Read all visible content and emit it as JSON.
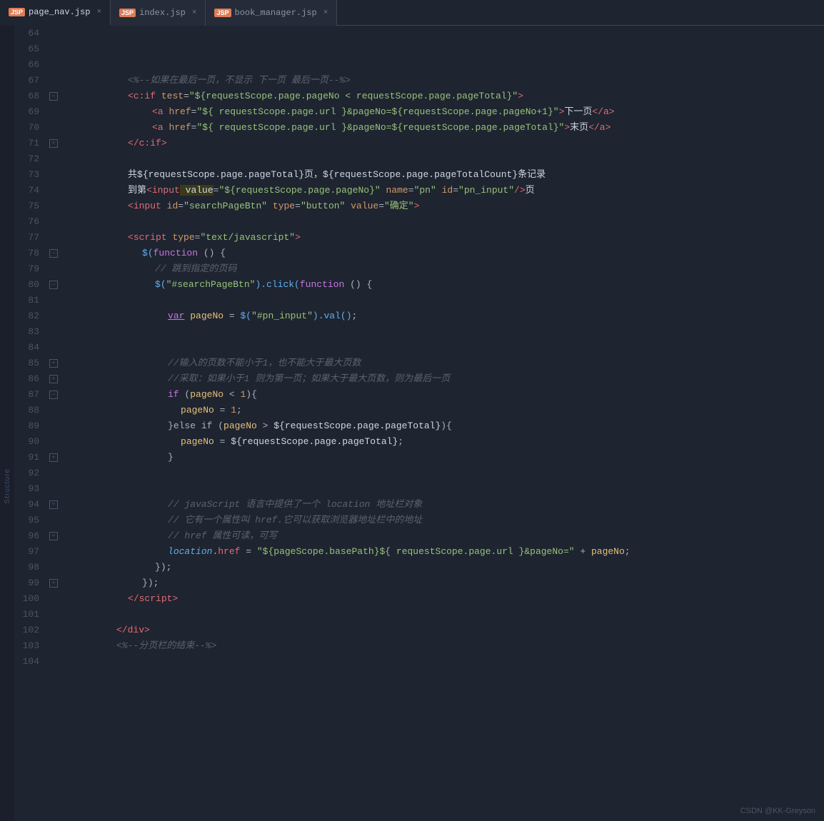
{
  "tabs": [
    {
      "label": "page_nav.jsp",
      "icon": "JSP",
      "active": true,
      "closable": true
    },
    {
      "label": "index.jsp",
      "icon": "JSP",
      "active": false,
      "closable": true
    },
    {
      "label": "book_manager.jsp",
      "icon": "JSP",
      "active": false,
      "closable": true
    }
  ],
  "lines": [
    {
      "num": 64,
      "gutter": "",
      "code": ""
    },
    {
      "num": 65,
      "gutter": "",
      "code": ""
    },
    {
      "num": 66,
      "gutter": "",
      "code": ""
    },
    {
      "num": 67,
      "gutter": "",
      "code": "    <span class='comment'>&lt;%--如果在最后一页，不显示 下一页 最后一页--%&gt;</span>"
    },
    {
      "num": 68,
      "gutter": "fold",
      "code": "    <span class='tag'>&lt;c:if</span> <span class='attr'>test</span><span class='punct'>=</span><span class='str'>\"${requestScope.page.pageNo &lt; requestScope.page.pageTotal}\"</span><span class='tag'>&gt;</span>"
    },
    {
      "num": 69,
      "gutter": "",
      "code": "        <span class='tag'>&lt;a</span> <span class='attr'>href</span><span class='punct'>=</span><span class='str'>\"${ requestScope.page.url }&amp;pageNo=${requestScope.page.pageNo+1}\"</span><span class='tag'>&gt;</span><span class='white'>下一页</span><span class='tag'>&lt;/a&gt;</span>"
    },
    {
      "num": 70,
      "gutter": "",
      "code": "        <span class='tag'>&lt;a</span> <span class='attr'>href</span><span class='punct'>=</span><span class='str'>\"${ requestScope.page.url }&amp;pageNo=${requestScope.page.pageTotal}\"</span><span class='tag'>&gt;</span><span class='white'>末页</span><span class='tag'>&lt;/a&gt;</span>"
    },
    {
      "num": 71,
      "gutter": "fold",
      "code": "    <span class='tag'>&lt;/c:if&gt;</span>"
    },
    {
      "num": 72,
      "gutter": "",
      "code": ""
    },
    {
      "num": 73,
      "gutter": "",
      "code": "    <span class='white'>共${requestScope.page.pageTotal}页，${requestScope.page.pageTotalCount}条记录</span>"
    },
    {
      "num": 74,
      "gutter": "",
      "code": "    <span class='white'>到第</span><span class='tag'>&lt;input</span> <span class='attr'>value</span><span class='punct'>=</span><span class='str'>\"${requestScope.page.pageNo}\"</span> <span class='attr'>name</span><span class='punct'>=</span><span class='str'>\"pn\"</span> <span class='attr'>id</span><span class='punct'>=</span><span class='str'>\"pn_input\"</span><span class='tag'>/&gt;</span><span class='white'>页</span>"
    },
    {
      "num": 75,
      "gutter": "",
      "code": "    <span class='tag'>&lt;input</span> <span class='attr'>id</span><span class='punct'>=</span><span class='str'>\"searchPageBtn\"</span> <span class='attr'>type</span><span class='punct'>=</span><span class='str'>\"button\"</span> <span class='attr'>value</span><span class='punct'>=</span><span class='str'>\"确定\"</span><span class='tag'>&gt;</span>"
    },
    {
      "num": 76,
      "gutter": "",
      "code": ""
    },
    {
      "num": 77,
      "gutter": "",
      "code": "    <span class='tag'>&lt;script</span> <span class='attr'>type</span><span class='punct'>=</span><span class='str'>\"text/javascript\"</span><span class='tag'>&gt;</span>"
    },
    {
      "num": 78,
      "gutter": "fold",
      "code": "        <span class='fn'>$(</span><span class='purple'>function</span> <span class='punct'>() {</span>"
    },
    {
      "num": 79,
      "gutter": "",
      "code": "            <span class='comment'>// 跳到指定的页码</span>"
    },
    {
      "num": 80,
      "gutter": "fold",
      "code": "            <span class='fn'>$(</span><span class='str'>\"#searchPageBtn\"</span><span class='fn'>).click(</span><span class='purple'>function</span> <span class='punct'>() {</span>"
    },
    {
      "num": 81,
      "gutter": "",
      "code": ""
    },
    {
      "num": 82,
      "gutter": "",
      "code": "                <span class='purple'>var</span> <span class='var-name'>pageNo</span> <span class='punct'>=</span> <span class='fn'>$(</span><span class='str'>\"#pn_input\"</span><span class='fn'>).val()</span><span class='punct'>;</span>"
    },
    {
      "num": 83,
      "gutter": "",
      "code": ""
    },
    {
      "num": 84,
      "gutter": "",
      "code": ""
    },
    {
      "num": 85,
      "gutter": "fold",
      "code": "                <span class='comment'>//输入的页数不能小于1，也不能大于最大页数</span>"
    },
    {
      "num": 86,
      "gutter": "fold",
      "code": "                <span class='comment'>//采取：如果小于1 则为第一页；如果大于最大页数，则为最后一页</span>"
    },
    {
      "num": 87,
      "gutter": "fold",
      "code": "                <span class='purple'>if</span> <span class='punct'>(</span><span class='var-name'>pageNo</span> <span class='punct'>&lt;</span> <span class='num'>1</span><span class='punct'>){</span>"
    },
    {
      "num": 88,
      "gutter": "",
      "code": "                    <span class='var-name'>pageNo</span> <span class='punct'>=</span> <span class='num'>1</span><span class='punct'>;</span>"
    },
    {
      "num": 89,
      "gutter": "",
      "code": "                <span class='punct'>}else if (</span><span class='var-name'>pageNo</span> <span class='punct'>&gt;</span> <span class='white'>${requestScope.page.pageTotal}</span><span class='punct'>){</span>"
    },
    {
      "num": 90,
      "gutter": "",
      "code": "                    <span class='var-name'>pageNo</span> <span class='punct'>=</span> <span class='white'>${requestScope.page.pageTotal}</span><span class='punct'>;</span>"
    },
    {
      "num": 91,
      "gutter": "fold",
      "code": "                <span class='punct'>}</span>"
    },
    {
      "num": 92,
      "gutter": "",
      "code": ""
    },
    {
      "num": 93,
      "gutter": "",
      "code": ""
    },
    {
      "num": 94,
      "gutter": "fold",
      "code": "                <span class='comment'>// javaScript 语言中提供了一个 location 地址栏对象</span>"
    },
    {
      "num": 95,
      "gutter": "",
      "code": "                <span class='comment'>// 它有一个属性叫 href.它可以获取浏览器地址栏中的地址</span>"
    },
    {
      "num": 96,
      "gutter": "fold",
      "code": "                <span class='comment'>// href 属性可读，可写</span>"
    },
    {
      "num": 97,
      "gutter": "",
      "code": "                <span class='italic-blue'>location</span><span class='punct'>.</span><span class='var'>href</span> <span class='punct'>=</span> <span class='str'>\"${pageScope.basePath}${ requestScope.page.url }&amp;pageNo=\"</span> <span class='punct'>+</span> <span class='var-name'>pageNo</span><span class='punct'>;</span>"
    },
    {
      "num": 98,
      "gutter": "",
      "code": "            <span class='punct'>});</span>"
    },
    {
      "num": 99,
      "gutter": "fold",
      "code": "        <span class='punct'>});</span>"
    },
    {
      "num": 100,
      "gutter": "",
      "code": "    <span class='tag'>&lt;/script&gt;</span>"
    },
    {
      "num": 101,
      "gutter": "",
      "code": ""
    },
    {
      "num": 102,
      "gutter": "",
      "code": "<span class='tag'>&lt;/div&gt;</span>"
    },
    {
      "num": 103,
      "gutter": "",
      "code": "<span class='comment'>&lt;%--分页栏的结束--%&gt;</span>"
    },
    {
      "num": 104,
      "gutter": "",
      "code": ""
    }
  ],
  "watermark": "CSDN @KK-Greyson",
  "structure_label": "Structure"
}
